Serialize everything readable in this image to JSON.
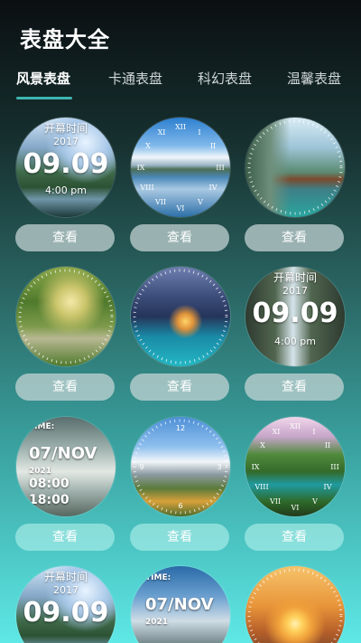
{
  "header": {
    "title": "表盘大全"
  },
  "tabs": [
    {
      "label": "风景表盘",
      "active": true
    },
    {
      "label": "卡通表盘",
      "active": false
    },
    {
      "label": "科幻表盘",
      "active": false
    },
    {
      "label": "温馨表盘",
      "active": false
    }
  ],
  "accent_color": "#3fb6b0",
  "view_label": "查看",
  "faces": [
    {
      "id": "face-1",
      "style": "digital-date",
      "caption": "开幕时间",
      "year": "2017",
      "date": "09.09",
      "time": "4:00 pm",
      "scene": "mountain-lake"
    },
    {
      "id": "face-2",
      "style": "roman-analog",
      "scene": "snowy-mountain-reflection"
    },
    {
      "id": "face-3",
      "style": "analog-ticks",
      "scene": "canyon-river-village"
    },
    {
      "id": "face-4",
      "style": "analog-ticks",
      "scene": "forest-path"
    },
    {
      "id": "face-5",
      "style": "analog-ticks",
      "scene": "coastal-town-night"
    },
    {
      "id": "face-6",
      "style": "digital-date",
      "caption": "开幕时间",
      "year": "2017",
      "date": "09.09",
      "time": "4:00 pm",
      "scene": "waterfall"
    },
    {
      "id": "face-7",
      "style": "nov-card",
      "time_label": "TIME:",
      "date": "07/NOV",
      "year": "2021",
      "time1": "08:00",
      "time2": "18:00",
      "scene": "misty-mountains"
    },
    {
      "id": "face-8",
      "style": "analog-ticks",
      "scene": "alpine-peaks"
    },
    {
      "id": "face-9",
      "style": "roman-analog",
      "scene": "green-lake-mountain"
    },
    {
      "id": "face-10",
      "style": "digital-date",
      "caption": "开幕时间",
      "year": "2017",
      "date": "09.09",
      "scene": "mountain-lake"
    },
    {
      "id": "face-11",
      "style": "nov-card",
      "time_label": "TIME:",
      "date": "07/NOV",
      "year": "2021",
      "scene": "misty-mountains"
    },
    {
      "id": "face-12",
      "style": "analog-ticks",
      "scene": "sunset-sea"
    }
  ]
}
